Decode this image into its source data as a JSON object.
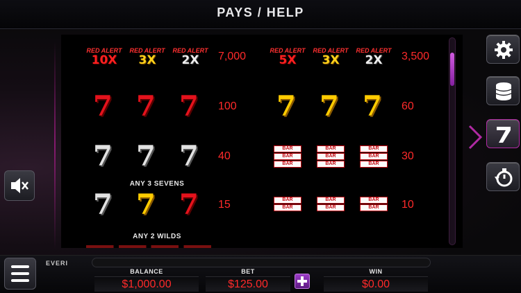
{
  "header": {
    "title": "PAYS / HELP"
  },
  "paytable": {
    "left": [
      {
        "symbols": [
          {
            "kind": "alert",
            "top": "RED ALERT",
            "mult": "10X",
            "color": "red"
          },
          {
            "kind": "alert",
            "top": "RED ALERT",
            "mult": "3X",
            "color": "gold"
          },
          {
            "kind": "alert",
            "top": "RED ALERT",
            "mult": "2X",
            "color": "silver"
          }
        ],
        "pay": "7,000"
      },
      {
        "symbols": [
          {
            "kind": "seven",
            "color": "red"
          },
          {
            "kind": "seven",
            "color": "red"
          },
          {
            "kind": "seven",
            "color": "red"
          }
        ],
        "pay": "100"
      },
      {
        "symbols": [
          {
            "kind": "seven",
            "color": "silver"
          },
          {
            "kind": "seven",
            "color": "silver"
          },
          {
            "kind": "seven",
            "color": "silver"
          }
        ],
        "pay": "40"
      },
      {
        "note": "ANY 3 SEVENS",
        "symbols": [
          {
            "kind": "seven",
            "color": "silver"
          },
          {
            "kind": "seven",
            "color": "gold"
          },
          {
            "kind": "seven",
            "color": "red"
          }
        ],
        "pay": "15"
      }
    ],
    "right": [
      {
        "symbols": [
          {
            "kind": "alert",
            "top": "RED ALERT",
            "mult": "5X",
            "color": "red"
          },
          {
            "kind": "alert",
            "top": "RED ALERT",
            "mult": "3X",
            "color": "gold"
          },
          {
            "kind": "alert",
            "top": "RED ALERT",
            "mult": "2X",
            "color": "silver"
          }
        ],
        "pay": "3,500"
      },
      {
        "symbols": [
          {
            "kind": "seven",
            "color": "gold"
          },
          {
            "kind": "seven",
            "color": "gold"
          },
          {
            "kind": "seven",
            "color": "gold"
          }
        ],
        "pay": "60"
      },
      {
        "symbols": [
          {
            "kind": "bar3"
          },
          {
            "kind": "bar3"
          },
          {
            "kind": "bar3"
          }
        ],
        "pay": "30"
      },
      {
        "symbols": [
          {
            "kind": "bar2"
          },
          {
            "kind": "bar2"
          },
          {
            "kind": "bar2"
          }
        ],
        "pay": "10"
      }
    ],
    "bar_label": "BAR",
    "footer_note": "ANY 2 WILDS"
  },
  "colors": {
    "accent": "#b02aa3",
    "pay_red": "#ff2a2a"
  },
  "icons": {
    "settings": "gear-icon",
    "bet_levels": "coin-stack-icon",
    "paytable": "seven-icon",
    "autoplay": "stopwatch-icon",
    "sound": "speaker-muted-icon",
    "menu": "hamburger-icon"
  },
  "scroll": {
    "position": 0.05
  },
  "footer": {
    "brand": "EVERI",
    "balance": {
      "label": "BALANCE",
      "value": "$1,000.00"
    },
    "bet": {
      "label": "BET",
      "value": "$125.00"
    },
    "win": {
      "label": "WIN",
      "value": "$0.00"
    }
  }
}
